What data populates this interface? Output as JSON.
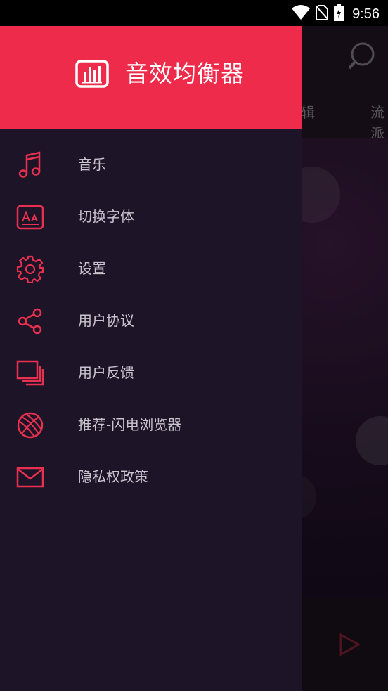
{
  "status_bar": {
    "time": "9:56",
    "icons": [
      "wifi-icon",
      "no-sim-icon",
      "battery-charging-icon"
    ]
  },
  "background_app": {
    "tabs": [
      "专辑",
      "流派"
    ],
    "icons": [
      "search-icon",
      "play-icon"
    ]
  },
  "drawer": {
    "title": "音效均衡器",
    "logo_icon": "equalizer-icon",
    "accent_color": "#ee2b4a",
    "background_color": "#1e1428",
    "items": [
      {
        "label": "音乐",
        "icon": "music-note-icon"
      },
      {
        "label": "切换字体",
        "icon": "font-icon"
      },
      {
        "label": "设置",
        "icon": "gear-icon"
      },
      {
        "label": "用户协议",
        "icon": "share-icon"
      },
      {
        "label": "用户反馈",
        "icon": "feedback-icon"
      },
      {
        "label": "推荐-闪电浏览器",
        "icon": "globe-icon"
      },
      {
        "label": "隐私权政策",
        "icon": "mail-icon"
      }
    ]
  }
}
